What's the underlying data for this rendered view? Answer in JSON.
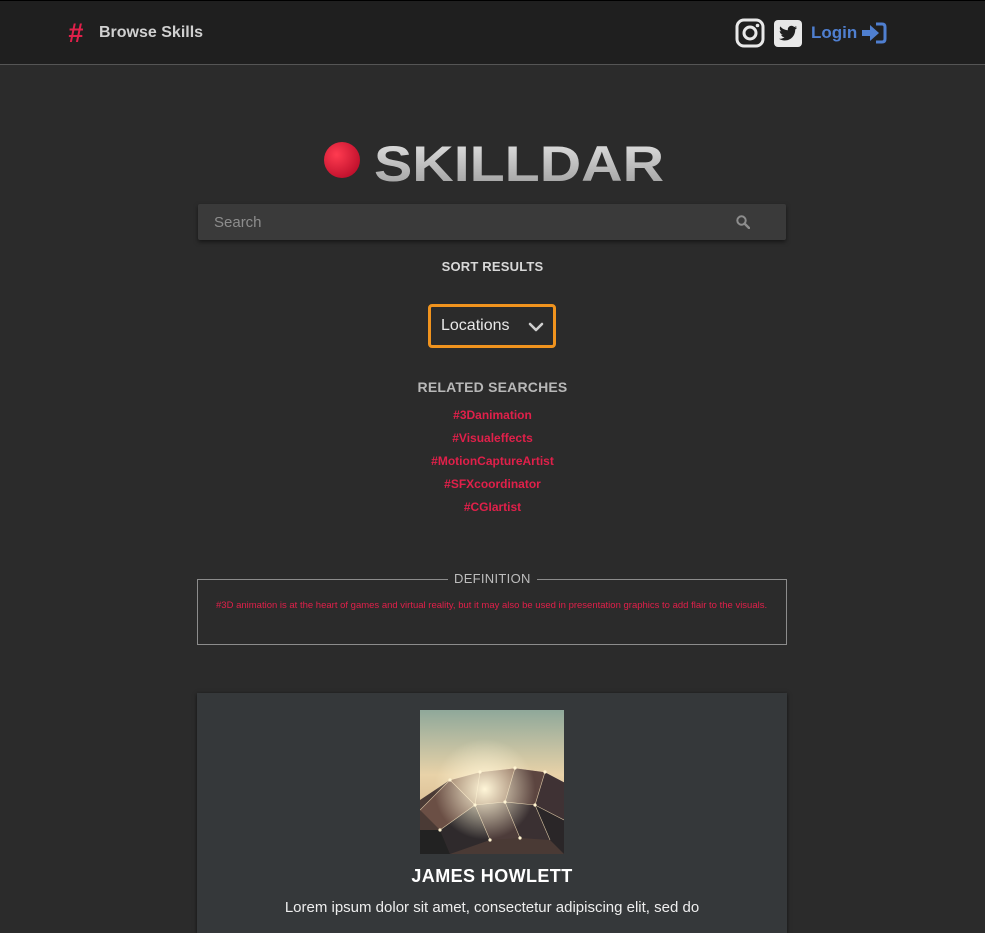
{
  "navbar": {
    "brand_icon": "hash-icon",
    "brand_label": "Browse Skills",
    "instagram_icon": "instagram-icon",
    "twitter_icon": "twitter-icon",
    "login_label": "Login",
    "login_icon": "sign-in-icon"
  },
  "logo": {
    "text": "SKILLDAR"
  },
  "search": {
    "placeholder": "Search",
    "value": ""
  },
  "sort": {
    "title": "SORT RESULTS",
    "selected": "Locations"
  },
  "related": {
    "title": "RELATED SEARCHES",
    "tags": [
      "#3Danimation",
      "#Visualeffects",
      "#MotionCaptureArtist",
      "#SFXcoordinator",
      "#CGIartist"
    ]
  },
  "definition": {
    "legend": "DEFINITION",
    "text": "#3D animation is at the heart of games and virtual reality, but it may also be used in presentation graphics to add flair to the visuals."
  },
  "profile": {
    "name": "JAMES HOWLETT",
    "bio": "Lorem ipsum dolor sit amet, consectetur adipiscing elit, sed do"
  },
  "colors": {
    "background": "#2b2b2b",
    "navbar": "#1f1f1f",
    "accent_red": "#e0204a",
    "link_blue": "#4f7fd0",
    "select_border": "#f0931e",
    "card": "#35383a"
  }
}
